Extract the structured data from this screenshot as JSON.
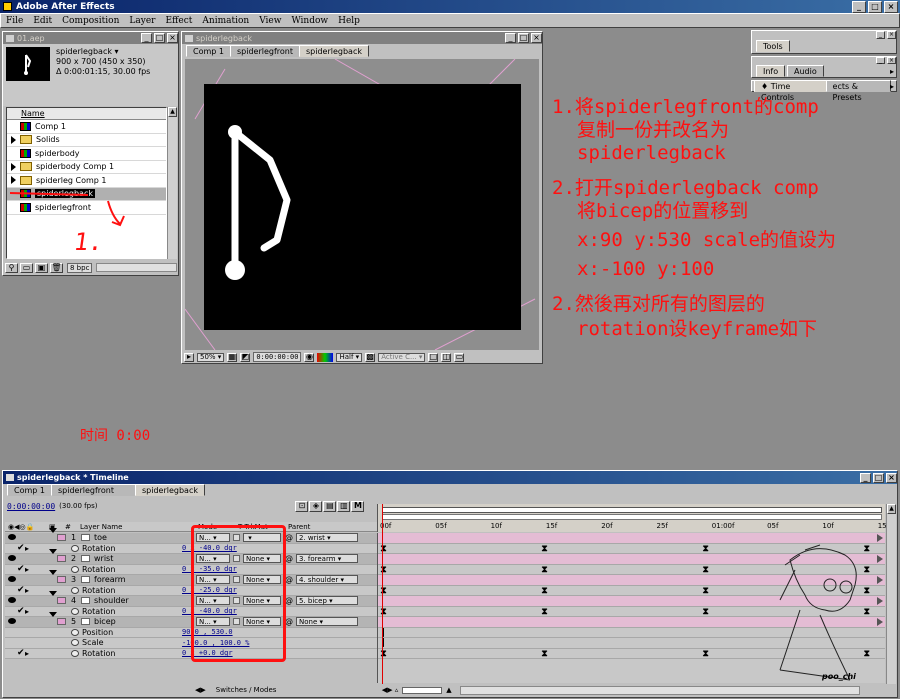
{
  "app": {
    "title": "Adobe After Effects",
    "menu": [
      "File",
      "Edit",
      "Composition",
      "Layer",
      "Effect",
      "Animation",
      "View",
      "Window",
      "Help"
    ]
  },
  "project": {
    "title": "01.aep",
    "comp_name": "spiderlegback",
    "comp_size": "900 x 700  (450 x 350)",
    "comp_duration": "Δ 0:00:01:15, 30.00 fps",
    "column_header": "Name",
    "items": [
      {
        "name": "Comp 1",
        "type": "comp",
        "expandable": false,
        "selected": false
      },
      {
        "name": "Solids",
        "type": "folder",
        "expandable": true,
        "selected": false
      },
      {
        "name": "spiderbody",
        "type": "comp",
        "expandable": false,
        "selected": false
      },
      {
        "name": "spiderbody Comp 1",
        "type": "folder",
        "expandable": true,
        "selected": false
      },
      {
        "name": "spiderleg Comp 1",
        "type": "folder",
        "expandable": true,
        "selected": false
      },
      {
        "name": "spiderlegback",
        "type": "comp",
        "expandable": false,
        "selected": true
      },
      {
        "name": "spiderlegfront",
        "type": "comp",
        "expandable": false,
        "selected": false
      }
    ],
    "bit_depth": "8 bpc",
    "annotation": "1."
  },
  "comp_window": {
    "title": "spiderlegback",
    "tabs": [
      "Comp 1",
      "spiderlegfront",
      "spiderlegback"
    ],
    "zoom": "50%",
    "timecode": "0:00:00:00",
    "resolution": "Half",
    "camera": "Active C..."
  },
  "palettes": {
    "tools": "Tools",
    "info_tabs": [
      "Info",
      "Audio"
    ],
    "time_tabs": [
      "Time Controls",
      "ects & Presets"
    ]
  },
  "instructions": [
    "1.将spiderlegfront的comp",
    "复制一份并改名为",
    "spiderlegback",
    "2.打开spiderlegback comp",
    "将bicep的位置移到",
    "x:90 y:530 scale的值设为",
    "x:-100 y:100",
    "2.然後再对所有的图层的",
    "rotation设keyframe如下"
  ],
  "time_label": "时间 0:00",
  "timeline": {
    "title": "spiderlegback * Timeline",
    "tabs": [
      "Comp 1",
      "spiderlegfront",
      "spiderlegback"
    ],
    "timecode": "0:00:00:00",
    "fps": "(30.00 fps)",
    "columns": {
      "layer_name": "Layer Name",
      "mode": "Mode",
      "trkmat": "T TrkMat",
      "parent": "Parent"
    },
    "ruler": [
      "00f",
      "05f",
      "10f",
      "15f",
      "20f",
      "25f",
      "01:00f",
      "05f",
      "10f",
      "15f"
    ],
    "rows": [
      {
        "kind": "layer",
        "num": "1",
        "name": "toe",
        "mode": "N...",
        "trkmat": "",
        "parent": "2. wrist"
      },
      {
        "kind": "prop",
        "name": "Rotation",
        "value": "0 x -40.0 dgr"
      },
      {
        "kind": "layer",
        "num": "2",
        "name": "wrist",
        "mode": "N...",
        "trkmat": "None",
        "parent": "3. forearm"
      },
      {
        "kind": "prop",
        "name": "Rotation",
        "value": "0 x -35.0 dgr"
      },
      {
        "kind": "layer",
        "num": "3",
        "name": "forearm",
        "mode": "N...",
        "trkmat": "None",
        "parent": "4. shoulder"
      },
      {
        "kind": "prop",
        "name": "Rotation",
        "value": "0 x -25.0 dgr"
      },
      {
        "kind": "layer",
        "num": "4",
        "name": "shoulder",
        "mode": "N...",
        "trkmat": "None",
        "parent": "5. bicep"
      },
      {
        "kind": "prop",
        "name": "Rotation",
        "value": "0 x -40.0 dgr"
      },
      {
        "kind": "layer",
        "num": "5",
        "name": "bicep",
        "mode": "N...",
        "trkmat": "None",
        "parent": "None"
      },
      {
        "kind": "prop",
        "name": "Position",
        "value": "90.0 , 530.0"
      },
      {
        "kind": "prop",
        "name": "Scale",
        "value": "-100.0 , 100.0 %"
      },
      {
        "kind": "prop",
        "name": "Rotation",
        "value": "0 x +0.0 dgr"
      }
    ],
    "footer": "Switches / Modes",
    "signature": "poo_chi"
  }
}
